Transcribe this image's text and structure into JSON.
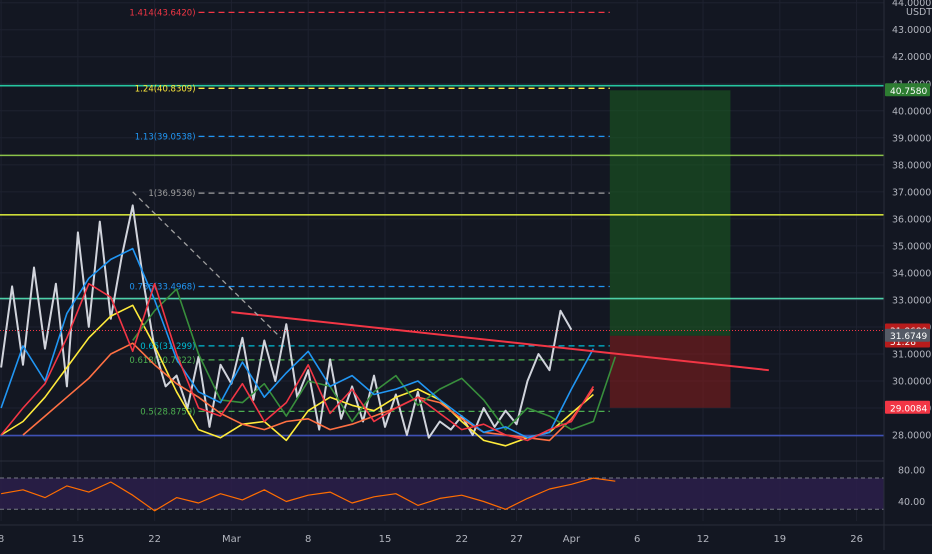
{
  "chart_data": {
    "type": "line",
    "instrument_quote": "USDT",
    "y_axis": {
      "currency_label": "USDT",
      "ticks": [
        "44.0000",
        "43.0000",
        "42.0000",
        "41.0000",
        "40.0000",
        "39.0000",
        "38.0000",
        "37.0000",
        "36.0000",
        "35.0000",
        "34.0000",
        "33.0000",
        "32.0000",
        "31.0000",
        "30.0000",
        "29.0000",
        "28.0000"
      ],
      "tick_values": [
        44,
        43,
        42,
        41,
        40,
        39,
        38,
        37,
        36,
        35,
        34,
        33,
        32,
        31,
        30,
        29,
        28
      ],
      "ylim": [
        27.15,
        44.1
      ]
    },
    "x_axis": {
      "tick_labels": [
        "8",
        "15",
        "22",
        "Mar",
        "8",
        "15",
        "22",
        "27",
        "Apr",
        "6",
        "12",
        "19",
        "26"
      ],
      "tick_days": [
        8,
        15,
        22,
        29,
        36,
        43,
        50,
        55,
        60,
        66,
        72,
        79,
        86
      ],
      "xlim_days": [
        7.9,
        88.5
      ]
    },
    "fib_levels": [
      {
        "label": "1.414(43.6420)",
        "value": 43.642,
        "color": "#f23645"
      },
      {
        "label": "1.24(40.8309)",
        "value": 40.8309,
        "color": "#ffeb3b"
      },
      {
        "label": "1.13(39.0538)",
        "value": 39.0538,
        "color": "#2196f3"
      },
      {
        "label": "1(36.9536)",
        "value": 36.9536,
        "color": "#9e9e9e"
      },
      {
        "label": "0.786(33.4968)",
        "value": 33.4968,
        "color": "#2196f3"
      },
      {
        "label": "0.65(31.299)",
        "value": 31.299,
        "color": "#00bcd4"
      },
      {
        "label": "0.618(30.7822)",
        "value": 30.7822,
        "color": "#4caf50"
      },
      {
        "label": "0.5(28.8759)",
        "value": 28.8759,
        "color": "#4caf50"
      }
    ],
    "horizontal_lines": [
      {
        "value": 40.93,
        "color": "#26c6a0"
      },
      {
        "value": 38.35,
        "color": "#8bc34a"
      },
      {
        "value": 36.15,
        "color": "#cddc39"
      },
      {
        "value": 33.05,
        "color": "#4dd0a8"
      },
      {
        "value": 27.98,
        "color": "#3f51b5"
      }
    ],
    "trendline": {
      "from": [
        29,
        32.55
      ],
      "to": [
        78,
        30.4
      ],
      "color": "#f23645"
    },
    "dashed_trend": {
      "from": [
        20,
        37.0
      ],
      "to": [
        33.5,
        31.6
      ],
      "color": "#9e9e9e"
    },
    "position": {
      "entry": 31.6749,
      "target": 40.758,
      "stop": 29.0084,
      "start_day": 63.5,
      "end_day": 74.5
    },
    "price_tags": [
      {
        "text": "40.7580",
        "value": 40.758,
        "bg": "#2e7d32",
        "fg": "#ffffff"
      },
      {
        "text": "31.8680",
        "value": 31.868,
        "bg": "#b71c1c",
        "fg": "#ffffff"
      },
      {
        "text": "51:28",
        "value": 31.46,
        "bg": "#b71c1c",
        "fg": "#ffffff"
      },
      {
        "text": "31.6749",
        "value": 31.6749,
        "bg": "#555a66",
        "fg": "#ffffff"
      },
      {
        "text": "29.0084",
        "value": 29.0084,
        "bg": "#f23645",
        "fg": "#ffffff"
      }
    ],
    "rsi": {
      "ticks": [
        "80.00",
        "40.00"
      ],
      "tick_values": [
        80,
        40
      ],
      "ylim": [
        15,
        88
      ],
      "band": [
        30,
        70
      ]
    },
    "series": [
      {
        "color": "#d1d4dc",
        "x": [
          8,
          9,
          10,
          11,
          12,
          13,
          14,
          15,
          16,
          17,
          18,
          19,
          20,
          21,
          22,
          23,
          24,
          25,
          26,
          27,
          28,
          29,
          30,
          31,
          32,
          33,
          34,
          35,
          36,
          37,
          38,
          39,
          40,
          41,
          42,
          43,
          44,
          45,
          46,
          47,
          48,
          49,
          50,
          51,
          52,
          53,
          54,
          55,
          56,
          57,
          58,
          59,
          60
        ],
        "y": [
          30.5,
          33.5,
          30.6,
          34.2,
          31.2,
          33.6,
          29.8,
          35.5,
          32.0,
          35.9,
          32.3,
          34.6,
          36.5,
          33.6,
          31.2,
          29.8,
          30.2,
          29.0,
          30.9,
          28.3,
          30.6,
          29.9,
          31.6,
          29.3,
          31.5,
          30.0,
          32.1,
          29.4,
          30.4,
          28.2,
          30.8,
          28.6,
          29.8,
          28.5,
          30.2,
          28.3,
          29.5,
          28.0,
          29.6,
          27.9,
          28.5,
          28.2,
          28.7,
          28.0,
          29.0,
          28.3,
          28.9,
          28.4,
          30.0,
          31.0,
          30.4,
          32.6,
          31.9
        ]
      },
      {
        "color": "#ffeb3b",
        "x": [
          8,
          10,
          12,
          14,
          16,
          18,
          20,
          22,
          24,
          26,
          28,
          30,
          32,
          34,
          36,
          38,
          40,
          42,
          44,
          46,
          48,
          50,
          52,
          54,
          56,
          58,
          60,
          62
        ],
        "y": [
          28.0,
          28.5,
          29.4,
          30.5,
          31.6,
          32.4,
          32.8,
          31.3,
          29.6,
          28.2,
          27.9,
          28.4,
          28.5,
          27.8,
          28.9,
          29.4,
          29.1,
          28.9,
          29.4,
          29.7,
          29.3,
          28.5,
          27.8,
          27.6,
          27.9,
          28.1,
          28.8,
          29.5
        ]
      },
      {
        "color": "#ff7043",
        "x": [
          10,
          12,
          14,
          16,
          18,
          20,
          22,
          24,
          26,
          28,
          30,
          32,
          34,
          36,
          38,
          40,
          42,
          44,
          46,
          48,
          50,
          52,
          54,
          56,
          58,
          60,
          62
        ],
        "y": [
          28.0,
          28.7,
          29.4,
          30.1,
          31.0,
          31.4,
          30.6,
          29.9,
          29.4,
          28.8,
          28.4,
          28.2,
          28.5,
          28.6,
          28.2,
          28.4,
          28.7,
          29.0,
          29.4,
          29.2,
          28.6,
          28.1,
          28.0,
          27.9,
          27.8,
          28.6,
          29.7
        ]
      },
      {
        "color": "#388e3c",
        "x": [
          20,
          22,
          24,
          26,
          28,
          30,
          32,
          34,
          36,
          38,
          40,
          42,
          44,
          46,
          48,
          50,
          52,
          54,
          56,
          58,
          60,
          62,
          64
        ],
        "y": [
          31.5,
          32.6,
          33.4,
          31.0,
          29.3,
          29.2,
          29.9,
          28.7,
          30.0,
          29.8,
          28.5,
          29.6,
          30.2,
          29.1,
          29.7,
          30.1,
          29.3,
          28.2,
          29.0,
          28.7,
          28.2,
          28.5,
          30.9
        ]
      },
      {
        "color": "#2196f3",
        "x": [
          8,
          10,
          12,
          14,
          16,
          18,
          20,
          22,
          24,
          26,
          28,
          30,
          32,
          34,
          36,
          38,
          40,
          42,
          44,
          46,
          48,
          50,
          52,
          54,
          56,
          58,
          60,
          62
        ],
        "y": [
          29.0,
          31.3,
          30.0,
          32.5,
          33.8,
          34.5,
          34.9,
          33.0,
          30.8,
          29.6,
          29.2,
          30.7,
          29.4,
          30.3,
          31.1,
          29.8,
          30.2,
          29.5,
          29.7,
          30.0,
          29.3,
          28.7,
          28.1,
          28.3,
          27.9,
          28.1,
          29.7,
          31.2
        ]
      },
      {
        "color": "#f23645",
        "x": [
          8,
          10,
          12,
          14,
          16,
          18,
          20,
          22,
          24,
          26,
          28,
          30,
          32,
          34,
          36,
          38,
          40,
          42,
          44,
          46,
          48,
          50,
          52,
          54,
          56,
          58,
          60,
          62
        ],
        "y": [
          28.0,
          29.0,
          29.9,
          31.6,
          33.6,
          33.1,
          31.1,
          33.6,
          31.0,
          29.0,
          28.7,
          29.9,
          28.5,
          29.2,
          30.6,
          28.8,
          29.7,
          28.5,
          29.0,
          29.4,
          28.8,
          28.2,
          28.4,
          28.0,
          27.8,
          28.2,
          28.5,
          29.8
        ]
      }
    ],
    "rsi_series": {
      "color": "#ff6d00",
      "x": [
        8,
        10,
        12,
        14,
        16,
        18,
        20,
        22,
        24,
        26,
        28,
        30,
        32,
        34,
        36,
        38,
        40,
        42,
        44,
        46,
        48,
        50,
        52,
        54,
        56,
        58,
        60,
        62,
        64
      ],
      "y": [
        50,
        55,
        45,
        60,
        52,
        65,
        48,
        28,
        45,
        38,
        50,
        42,
        55,
        40,
        48,
        52,
        38,
        46,
        50,
        35,
        44,
        48,
        40,
        30,
        44,
        56,
        62,
        70,
        66
      ]
    }
  },
  "colors": {
    "background": "#131722",
    "grid": "#1e2230",
    "axis_text": "#b2b5be",
    "rsi_band": "#2b1e4a"
  }
}
